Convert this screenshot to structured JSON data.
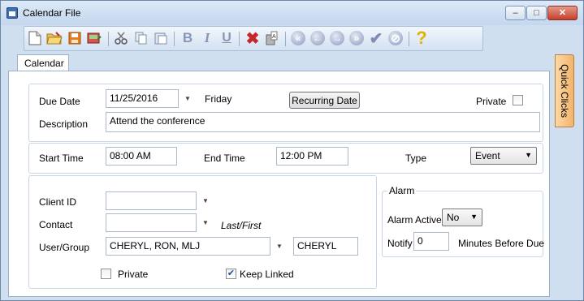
{
  "window": {
    "title": "Calendar File",
    "minimize": "–",
    "maximize": "□",
    "close": "✕"
  },
  "toolbar": {
    "buttons": [
      "new-document",
      "open-folder",
      "save",
      "save-and-close",
      "cut",
      "copy",
      "paste",
      "bold",
      "italic",
      "underline",
      "delete",
      "spelling",
      "first-record",
      "previous-record",
      "next-record",
      "last-record",
      "checkmark",
      "cancel",
      "help"
    ],
    "bold_label": "B",
    "italic_label": "I",
    "underline_label": "U",
    "help_label": "?"
  },
  "tabs": {
    "calendar": "Calendar",
    "quick_clicks": "Quick Clicks"
  },
  "due": {
    "label": "Due Date",
    "value": "11/25/2016",
    "day": "Friday",
    "recurring_button": "Recurring Date",
    "private_label": "Private",
    "private_checked": false
  },
  "description": {
    "label": "Description",
    "value": "Attend the conference"
  },
  "time": {
    "start_label": "Start Time",
    "start_value": "08:00 AM",
    "end_label": "End Time",
    "end_value": "12:00 PM",
    "type_label": "Type",
    "type_value": "Event"
  },
  "client": {
    "client_id_label": "Client ID",
    "client_id_value": "",
    "contact_label": "Contact",
    "contact_value": "",
    "contact_hint": "Last/First",
    "user_group_label": "User/Group",
    "user_group_value": "CHERYL, RON, MLJ",
    "user_value": "CHERYL",
    "private_label": "Private",
    "private_checked": false,
    "keep_linked_label": "Keep Linked",
    "keep_linked_checked": true
  },
  "alarm": {
    "legend": "Alarm",
    "active_label": "Alarm Active",
    "active_value": "No",
    "notify_label": "Notify",
    "notify_value": "0",
    "notify_suffix": "Minutes Before Due"
  },
  "colors": {
    "frame": "#cfdff0",
    "accent_tab": "#f3b36a",
    "check": "#234d9a"
  }
}
